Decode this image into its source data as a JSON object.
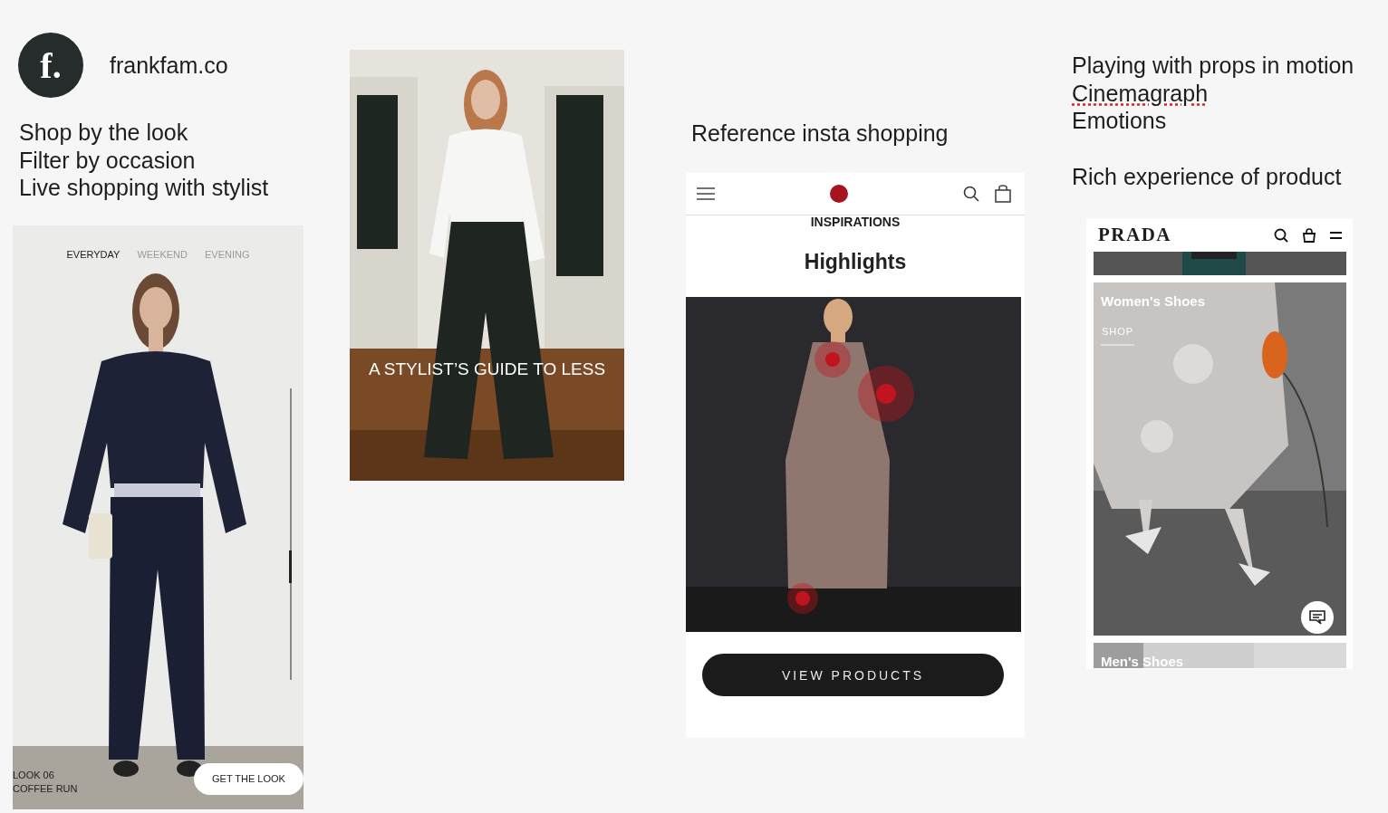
{
  "brand": {
    "logo_letter": "f.",
    "name": "frankfam.co"
  },
  "look_notes": [
    "Shop by the look",
    "Filter by occasion",
    "Live shopping with stylist"
  ],
  "look_screen": {
    "tabs": [
      {
        "label": "EVERYDAY",
        "selected": true
      },
      {
        "label": "WEEKEND",
        "selected": false
      },
      {
        "label": "EVENING",
        "selected": false
      }
    ],
    "look_number": "LOOK 06",
    "look_name": "COFFEE RUN",
    "button": "GET THE LOOK"
  },
  "guide_card": {
    "caption": "A STYLIST’S GUIDE TO LESS"
  },
  "insta_section": {
    "title": "Reference insta shopping",
    "screen": {
      "eyebrow": "INSPIRATIONS",
      "heading": "Highlights",
      "button": "VIEW PRODUCTS"
    }
  },
  "product_section": {
    "notes": [
      {
        "text": "Playing with props in motion",
        "spelling_flagged": false
      },
      {
        "text": "Cinemagraph",
        "spelling_flagged": true
      },
      {
        "text": "Emotions",
        "spelling_flagged": false
      }
    ],
    "note": "Rich experience of product",
    "screen": {
      "logo": "PRADA",
      "categories": [
        {
          "title": "Women's Shoes",
          "link": "SHOP"
        },
        {
          "title": "Men's Shoes"
        }
      ]
    }
  }
}
